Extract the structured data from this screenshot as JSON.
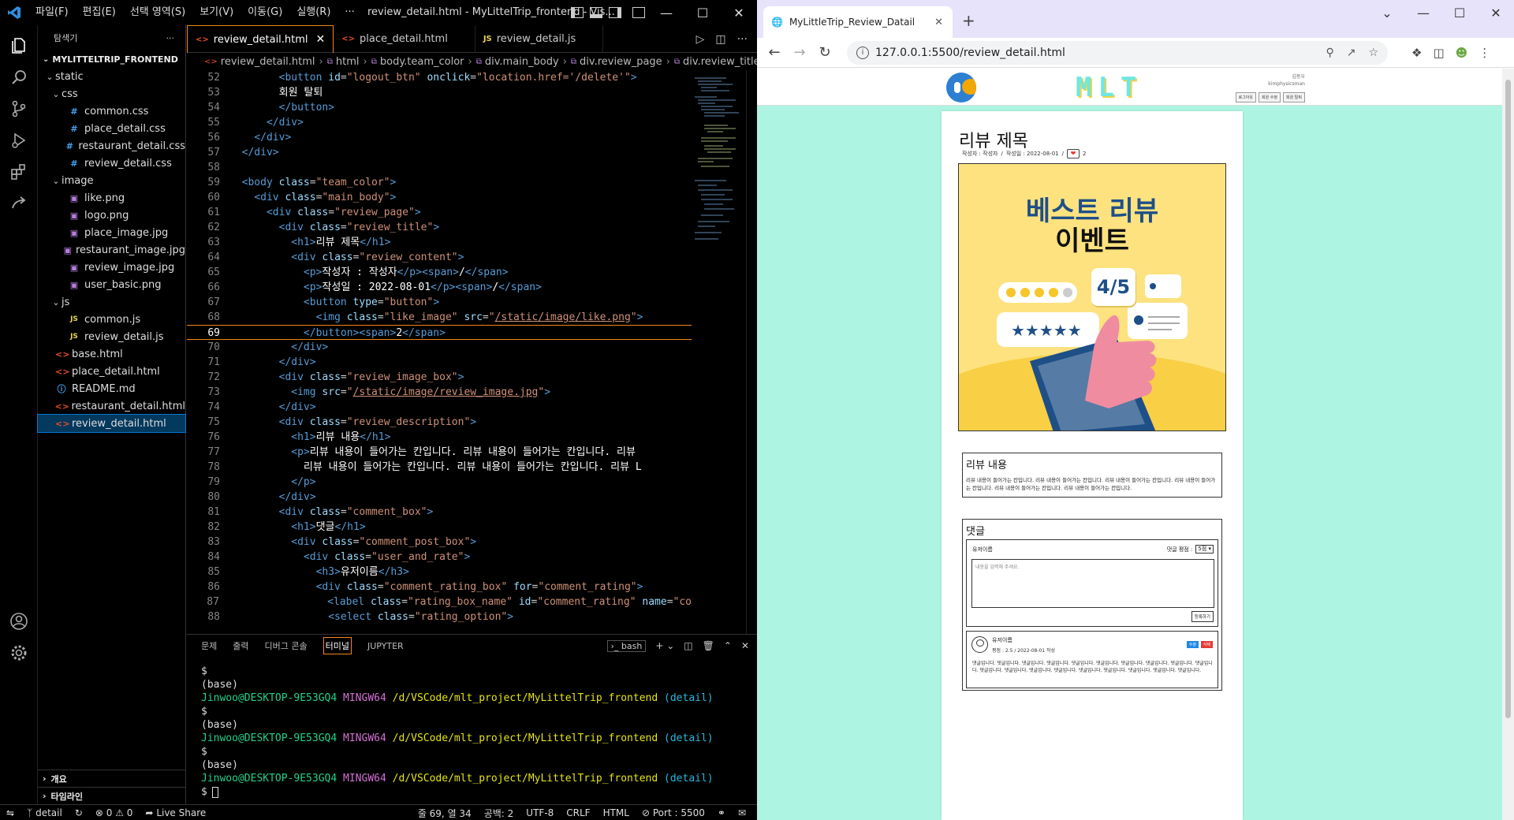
{
  "vscode": {
    "menus": [
      "파일(F)",
      "편집(E)",
      "선택 영역(S)",
      "보기(V)",
      "이동(G)",
      "실행(R)",
      "···"
    ],
    "window_title": "review_detail.html - MyLittelTrip_frontend - Vis...",
    "explorer_title": "탐색기",
    "project": "MYLITTELTRIP_FRONTEND",
    "tree": [
      {
        "type": "folder",
        "name": "static",
        "indent": 1
      },
      {
        "type": "folder",
        "name": "css",
        "indent": 2
      },
      {
        "type": "css",
        "name": "common.css",
        "indent": 3
      },
      {
        "type": "css",
        "name": "place_detail.css",
        "indent": 3
      },
      {
        "type": "css",
        "name": "restaurant_detail.css",
        "indent": 3
      },
      {
        "type": "css",
        "name": "review_detail.css",
        "indent": 3
      },
      {
        "type": "folder",
        "name": "image",
        "indent": 2
      },
      {
        "type": "img",
        "name": "like.png",
        "indent": 3
      },
      {
        "type": "img",
        "name": "logo.png",
        "indent": 3
      },
      {
        "type": "img",
        "name": "place_image.jpg",
        "indent": 3
      },
      {
        "type": "img",
        "name": "restaurant_image.jpg",
        "indent": 3
      },
      {
        "type": "img",
        "name": "review_image.jpg",
        "indent": 3
      },
      {
        "type": "img",
        "name": "user_basic.png",
        "indent": 3
      },
      {
        "type": "folder",
        "name": "js",
        "indent": 2
      },
      {
        "type": "js",
        "name": "common.js",
        "indent": 3
      },
      {
        "type": "js",
        "name": "review_detail.js",
        "indent": 3
      },
      {
        "type": "html",
        "name": "base.html",
        "indent": 1
      },
      {
        "type": "html",
        "name": "place_detail.html",
        "indent": 1
      },
      {
        "type": "md",
        "name": "README.md",
        "indent": 1
      },
      {
        "type": "html",
        "name": "restaurant_detail.html",
        "indent": 1
      },
      {
        "type": "html",
        "name": "review_detail.html",
        "indent": 1,
        "selected": true
      }
    ],
    "bottom_sections": [
      "개요",
      "타임라인"
    ],
    "tabs": [
      {
        "label": "review_detail.html",
        "icon": "<>",
        "active": true
      },
      {
        "label": "place_detail.html",
        "icon": "<>",
        "active": false
      },
      {
        "label": "review_detail.js",
        "icon": "JS",
        "active": false
      }
    ],
    "breadcrumb": [
      "review_detail.html",
      "html",
      "body.team_color",
      "div.main_body",
      "div.review_page",
      "div.review_title"
    ],
    "code": [
      {
        "n": "52",
        "h": "        <span class=\"tk-tag\">&lt;button</span> <span class=\"tk-attr\">id</span>=<span class=\"tk-str\">\"logout_btn\"</span> <span class=\"tk-attr\">onclick</span>=<span class=\"tk-str\">\"location.href='/delete'\"</span><span class=\"tk-tag\">&gt;</span>"
      },
      {
        "n": "53",
        "h": "        <span class=\"tk-txt\">회원 탈퇴</span>"
      },
      {
        "n": "54",
        "h": "        <span class=\"tk-tag\">&lt;/button&gt;</span>"
      },
      {
        "n": "55",
        "h": "      <span class=\"tk-tag\">&lt;/div&gt;</span>"
      },
      {
        "n": "56",
        "h": "    <span class=\"tk-tag\">&lt;/div&gt;</span>"
      },
      {
        "n": "57",
        "h": "  <span class=\"tk-tag\">&lt;/div&gt;</span>"
      },
      {
        "n": "58",
        "h": ""
      },
      {
        "n": "59",
        "h": "  <span class=\"tk-tag\">&lt;body</span> <span class=\"tk-attr\">class</span>=<span class=\"tk-str\">\"team_color\"</span><span class=\"tk-tag\">&gt;</span>"
      },
      {
        "n": "60",
        "h": "    <span class=\"tk-tag\">&lt;div</span> <span class=\"tk-attr\">class</span>=<span class=\"tk-str\">\"main_body\"</span><span class=\"tk-tag\">&gt;</span>"
      },
      {
        "n": "61",
        "h": "      <span class=\"tk-tag\">&lt;div</span> <span class=\"tk-attr\">class</span>=<span class=\"tk-str\">\"review_page\"</span><span class=\"tk-tag\">&gt;</span>"
      },
      {
        "n": "62",
        "h": "        <span class=\"tk-tag\">&lt;div</span> <span class=\"tk-attr\">class</span>=<span class=\"tk-str\">\"review_title\"</span><span class=\"tk-tag\">&gt;</span>"
      },
      {
        "n": "63",
        "h": "          <span class=\"tk-tag\">&lt;h1&gt;</span><span class=\"tk-txt\">리뷰 제목</span><span class=\"tk-tag\">&lt;/h1&gt;</span>"
      },
      {
        "n": "64",
        "h": "          <span class=\"tk-tag\">&lt;div</span> <span class=\"tk-attr\">class</span>=<span class=\"tk-str\">\"review_content\"</span><span class=\"tk-tag\">&gt;</span>"
      },
      {
        "n": "65",
        "h": "            <span class=\"tk-tag\">&lt;p&gt;</span><span class=\"tk-txt\">작성자 : 작성자</span><span class=\"tk-tag\">&lt;/p&gt;&lt;span&gt;</span><span class=\"tk-txt\">/</span><span class=\"tk-tag\">&lt;/span&gt;</span>"
      },
      {
        "n": "66",
        "h": "            <span class=\"tk-tag\">&lt;p&gt;</span><span class=\"tk-txt\">작성일 : 2022-08-01</span><span class=\"tk-tag\">&lt;/p&gt;&lt;span&gt;</span><span class=\"tk-txt\">/</span><span class=\"tk-tag\">&lt;/span&gt;</span>"
      },
      {
        "n": "67",
        "h": "            <span class=\"tk-tag\">&lt;button</span> <span class=\"tk-attr\">type</span>=<span class=\"tk-str\">\"button\"</span><span class=\"tk-tag\">&gt;</span>"
      },
      {
        "n": "68",
        "h": "              <span class=\"tk-tag\">&lt;img</span> <span class=\"tk-attr\">class</span>=<span class=\"tk-str\">\"like_image\"</span> <span class=\"tk-attr\">src</span>=<span class=\"tk-str\">\"<span class=\"tk-link\">/static/image/like.png</span>\"</span><span class=\"tk-tag\">&gt;</span>"
      },
      {
        "n": "69",
        "h": "            <span class=\"tk-tag\">&lt;/button&gt;&lt;span&gt;</span><span class=\"tk-txt\">2</span><span class=\"tk-tag\">&lt;/span&gt;</span>",
        "cur": true
      },
      {
        "n": "70",
        "h": "          <span class=\"tk-tag\">&lt;/div&gt;</span>"
      },
      {
        "n": "71",
        "h": "        <span class=\"tk-tag\">&lt;/div&gt;</span>"
      },
      {
        "n": "72",
        "h": "        <span class=\"tk-tag\">&lt;div</span> <span class=\"tk-attr\">class</span>=<span class=\"tk-str\">\"review_image_box\"</span><span class=\"tk-tag\">&gt;</span>"
      },
      {
        "n": "73",
        "h": "          <span class=\"tk-tag\">&lt;img</span> <span class=\"tk-attr\">src</span>=<span class=\"tk-str\">\"<span class=\"tk-link\">/static/image/review_image.jpg</span>\"</span><span class=\"tk-tag\">&gt;</span>"
      },
      {
        "n": "74",
        "h": "        <span class=\"tk-tag\">&lt;/div&gt;</span>"
      },
      {
        "n": "75",
        "h": "        <span class=\"tk-tag\">&lt;div</span> <span class=\"tk-attr\">class</span>=<span class=\"tk-str\">\"review_description\"</span><span class=\"tk-tag\">&gt;</span>"
      },
      {
        "n": "76",
        "h": "          <span class=\"tk-tag\">&lt;h1&gt;</span><span class=\"tk-txt\">리뷰 내용</span><span class=\"tk-tag\">&lt;/h1&gt;</span>"
      },
      {
        "n": "77",
        "h": "          <span class=\"tk-tag\">&lt;p&gt;</span><span class=\"tk-txt\">리뷰 내용이 들어가는 칸입니다. 리뷰 내용이 들어가는 칸입니다. 리뷰</span>"
      },
      {
        "n": "78",
        "h": "            <span class=\"tk-txt\">리뷰 내용이 들어가는 칸입니다. 리뷰 내용이 들어가는 칸입니다. 리뷰 L</span>"
      },
      {
        "n": "79",
        "h": "          <span class=\"tk-tag\">&lt;/p&gt;</span>"
      },
      {
        "n": "80",
        "h": "        <span class=\"tk-tag\">&lt;/div&gt;</span>"
      },
      {
        "n": "81",
        "h": "        <span class=\"tk-tag\">&lt;div</span> <span class=\"tk-attr\">class</span>=<span class=\"tk-str\">\"comment_box\"</span><span class=\"tk-tag\">&gt;</span>"
      },
      {
        "n": "82",
        "h": "          <span class=\"tk-tag\">&lt;h1&gt;</span><span class=\"tk-txt\">댓글</span><span class=\"tk-tag\">&lt;/h1&gt;</span>"
      },
      {
        "n": "83",
        "h": "          <span class=\"tk-tag\">&lt;div</span> <span class=\"tk-attr\">class</span>=<span class=\"tk-str\">\"comment_post_box\"</span><span class=\"tk-tag\">&gt;</span>"
      },
      {
        "n": "84",
        "h": "            <span class=\"tk-tag\">&lt;div</span> <span class=\"tk-attr\">class</span>=<span class=\"tk-str\">\"user_and_rate\"</span><span class=\"tk-tag\">&gt;</span>"
      },
      {
        "n": "85",
        "h": "              <span class=\"tk-tag\">&lt;h3&gt;</span><span class=\"tk-txt\">유저이름</span><span class=\"tk-tag\">&lt;/h3&gt;</span>"
      },
      {
        "n": "86",
        "h": "              <span class=\"tk-tag\">&lt;div</span> <span class=\"tk-attr\">class</span>=<span class=\"tk-str\">\"comment_rating_box\"</span> <span class=\"tk-attr\">for</span>=<span class=\"tk-str\">\"comment_rating\"</span><span class=\"tk-tag\">&gt;</span>"
      },
      {
        "n": "87",
        "h": "                <span class=\"tk-tag\">&lt;label</span> <span class=\"tk-attr\">class</span>=<span class=\"tk-str\">\"rating_box_name\"</span> <span class=\"tk-attr\">id</span>=<span class=\"tk-str\">\"comment_rating\"</span> <span class=\"tk-attr\">name</span>=<span class=\"tk-str\">\"co</span>"
      },
      {
        "n": "88",
        "h": "                <span class=\"tk-tag\">&lt;select</span> <span class=\"tk-attr\">class</span>=<span class=\"tk-str\">\"rating_option\"</span><span class=\"tk-tag\">&gt;</span>"
      }
    ],
    "panel_tabs": [
      "문제",
      "출력",
      "디버그 콘솔",
      "터미널",
      "JUPYTER"
    ],
    "panel_active": "터미널",
    "panel_shell": "bash",
    "terminal": {
      "user": "Jinwoo@DESKTOP-9E53GQ4",
      "sys": "MINGW64",
      "path": "/d/VSCode/mlt_project/MyLittelTrip_frontend",
      "branch": "(detail)",
      "base": "(base)",
      "prompt": "$"
    },
    "status": {
      "branch": "detail",
      "problems": "⊗ 0 ⚠ 0",
      "live_share": "Live Share",
      "position": "줄 69, 열 34",
      "spaces": "공백: 2",
      "encoding": "UTF-8",
      "eol": "CRLF",
      "language": "HTML",
      "port": "Port : 5500"
    }
  },
  "chrome": {
    "tab_title": "MyLittleTrip_Review_Datail",
    "url": "127.0.0.1:5500/review_detail.html",
    "page": {
      "brand": "MLT",
      "user_name": "김동우",
      "user_email": "kimphysicsman",
      "user_buttons": [
        "로그아웃",
        "회원 수정",
        "회원 탈퇴"
      ],
      "title": "리뷰 제목",
      "meta_author": "작성자 : 작성자",
      "meta_date": "작성일 : 2022-08-01",
      "meta_sep": "/",
      "like_count": "2",
      "image_title1": "베스트 리뷰",
      "image_title2": "이벤트",
      "image_rating": "4/5",
      "desc_heading": "리뷰 내용",
      "desc_text": "리뷰 내용이 들어가는 칸입니다. 리뷰 내용이 들어가는 칸입니다. 리뷰 내용이 들어가는 칸입니다. 리뷰 내용이 들어가는 칸입니다. 리뷰 내용이 들어가는 칸입니다. 리뷰 내용이 들어가는 칸입니다.",
      "comments_heading": "댓글",
      "post_user": "유저이름",
      "rating_label": "댓글 평점 :",
      "rating_value": "5점",
      "comment_placeholder": "내용을 입력해 주세요.",
      "post_button": "등록하기",
      "comment_user": "유저이름",
      "comment_meta": "평점 : 2.5  /  2022-08-01 작성",
      "comment_edit": "수정",
      "comment_delete": "삭제",
      "comment_text": "댓글입니다. 댓글입니다. 댓글입니다. 댓글입니다. 댓글입니다. 댓글입니다. 댓글입니다. 댓글입니다. 댓글입니다. 댓글입니다. 댓글입니다. 댓글입니다. 댓글입니다. 댓글입니다. 댓글입니다. 댓글입니다. 댓글입니다. 댓글입니다. 댓글입니다."
    }
  },
  "colors": {
    "accent": "#f38518",
    "page_bg": "#adf5e2",
    "tabstrip": "#e7e3fa",
    "image_bg": "#fde27f"
  }
}
